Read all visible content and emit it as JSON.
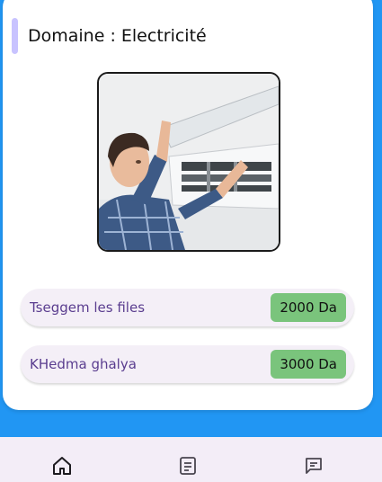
{
  "domain": {
    "title": "Domaine : Electricité",
    "accent_color": "#c8c3ff"
  },
  "photo": {
    "subject": "technician servicing an air conditioner"
  },
  "services": [
    {
      "name": "Tseggem les files",
      "price": "2000 Da"
    },
    {
      "name": "KHedma ghalya",
      "price": "3000 Da"
    }
  ],
  "colors": {
    "background": "#2196f3",
    "card": "#ffffff",
    "row_background": "#f4eff7",
    "row_text": "#5a3d8f",
    "price_badge": "#7ac47c",
    "nav_background": "#f3edf7"
  },
  "bottom_nav": {
    "items": [
      {
        "icon": "home-icon"
      },
      {
        "icon": "document-icon"
      },
      {
        "icon": "chat-icon"
      }
    ]
  }
}
